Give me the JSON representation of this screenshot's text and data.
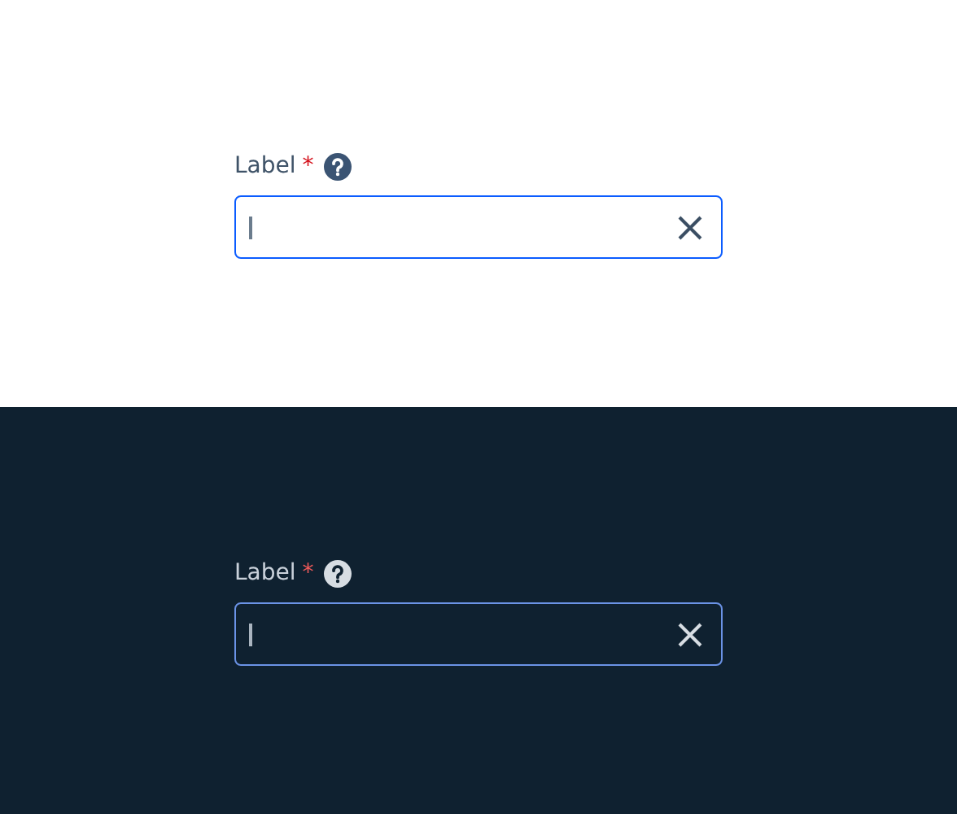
{
  "panels": [
    {
      "dark": false,
      "label": "Label",
      "required_mark": "*",
      "focused": true
    },
    {
      "dark": true,
      "label": "Label",
      "required_mark": "*",
      "focused": true
    }
  ]
}
